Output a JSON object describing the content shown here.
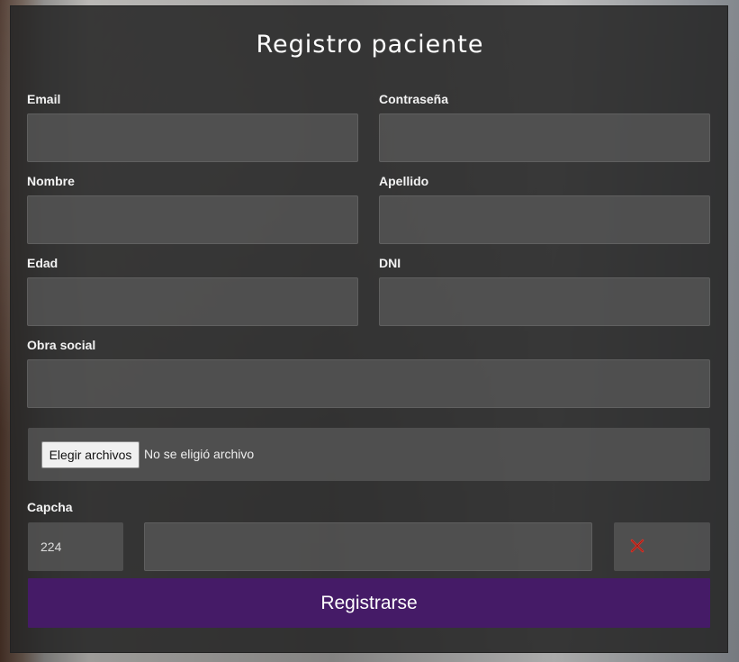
{
  "form": {
    "title": "Registro paciente",
    "fields": {
      "email": {
        "label": "Email",
        "value": ""
      },
      "password": {
        "label": "Contraseña",
        "value": ""
      },
      "first_name": {
        "label": "Nombre",
        "value": ""
      },
      "last_name": {
        "label": "Apellido",
        "value": ""
      },
      "age": {
        "label": "Edad",
        "value": ""
      },
      "dni": {
        "label": "DNI",
        "value": ""
      },
      "insurance": {
        "label": "Obra social",
        "value": ""
      }
    },
    "file": {
      "button_label": "Elegir archivos",
      "status": "No se eligió archivo"
    },
    "captcha": {
      "label": "Capcha",
      "code": "224",
      "value": "",
      "status_icon": "x-icon",
      "status_color": "#d9352b"
    },
    "submit_label": "Registrarse",
    "submit_color": "#451b67"
  }
}
